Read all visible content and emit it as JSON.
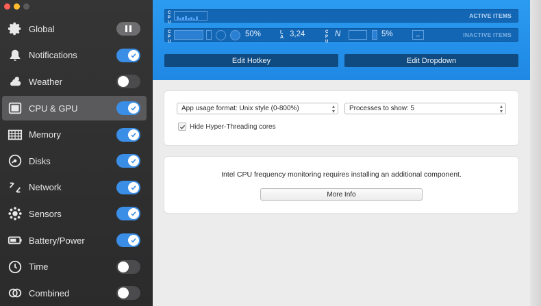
{
  "window": {
    "traffic_lights": [
      "close",
      "minimize",
      "zoom"
    ]
  },
  "colors": {
    "accent": "#3a8ee6",
    "header": "#1f88e4",
    "sidebar": "#2f2f30"
  },
  "sidebar": {
    "items": [
      {
        "label": "Global",
        "icon": "gear-icon",
        "control": "pause",
        "selected": false
      },
      {
        "label": "Notifications",
        "icon": "bell-icon",
        "control": "on",
        "selected": false
      },
      {
        "label": "Weather",
        "icon": "cloud-sun-icon",
        "control": "off",
        "selected": false
      },
      {
        "label": "CPU & GPU",
        "icon": "cpu-icon",
        "control": "on",
        "selected": true
      },
      {
        "label": "Memory",
        "icon": "memory-icon",
        "control": "on",
        "selected": false
      },
      {
        "label": "Disks",
        "icon": "disk-icon",
        "control": "on",
        "selected": false
      },
      {
        "label": "Network",
        "icon": "network-icon",
        "control": "on",
        "selected": false
      },
      {
        "label": "Sensors",
        "icon": "sensors-icon",
        "control": "on",
        "selected": false
      },
      {
        "label": "Battery/Power",
        "icon": "battery-icon",
        "control": "on",
        "selected": false
      },
      {
        "label": "Time",
        "icon": "clock-icon",
        "control": "off",
        "selected": false
      },
      {
        "label": "Combined",
        "icon": "combined-icon",
        "control": "off",
        "selected": false
      }
    ]
  },
  "menubar_preview": {
    "active_label": "ACTIVE ITEMS",
    "inactive_label": "INACTIVE ITEMS",
    "cpu_stack": "C\nP\nU",
    "percent_1": "50%",
    "load_value": "3,24",
    "n_label": "N",
    "percent_2": "5%"
  },
  "buttons": {
    "edit_hotkey": "Edit Hotkey",
    "edit_dropdown": "Edit Dropdown"
  },
  "settings": {
    "app_usage_format": "App usage format: Unix style (0-800%)",
    "processes_to_show": "Processes to show: 5",
    "hide_hyperthreading_label": "Hide Hyper-Threading cores",
    "hide_hyperthreading_checked": true
  },
  "intel_notice": {
    "text": "Intel CPU frequency monitoring requires installing an additional component.",
    "button": "More Info"
  }
}
